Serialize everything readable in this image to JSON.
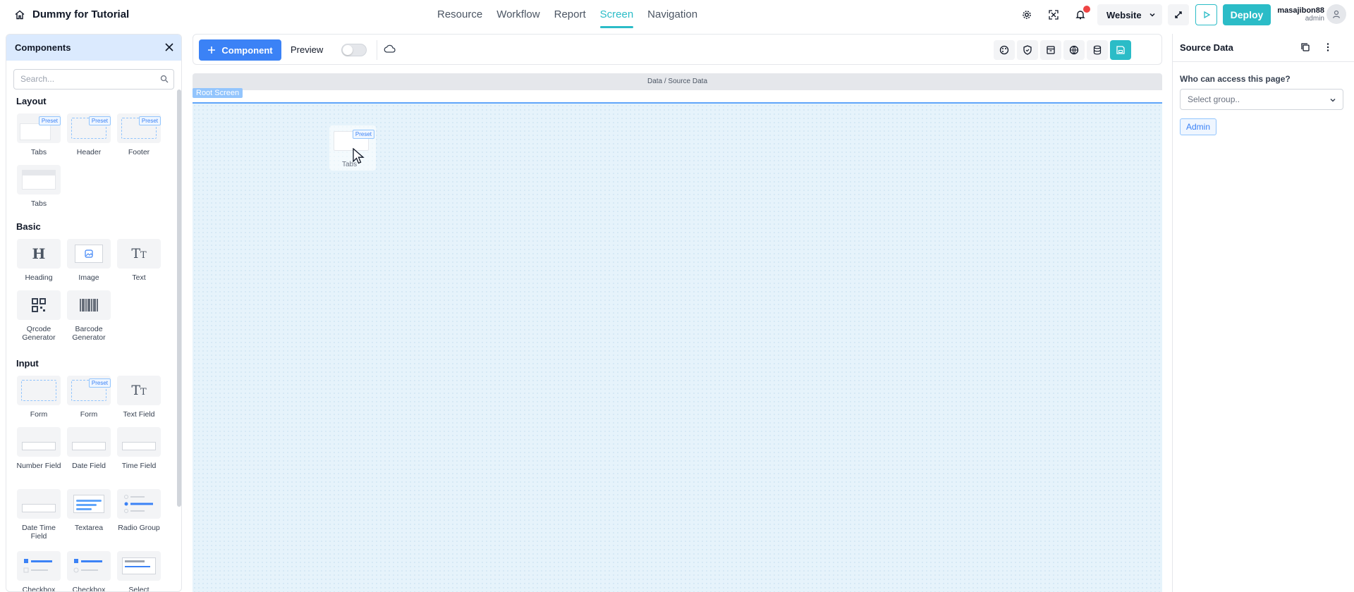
{
  "app": {
    "title": "Dummy for Tutorial"
  },
  "nav": {
    "items": [
      "Resource",
      "Workflow",
      "Report",
      "Screen",
      "Navigation"
    ],
    "active": "Screen"
  },
  "topbar": {
    "environment": "Website",
    "deploy_label": "Deploy",
    "user_name": "masajibon88",
    "user_role": "admin"
  },
  "left_panel": {
    "title": "Components",
    "search_placeholder": "Search...",
    "preset_label": "Preset",
    "sections": {
      "layout": {
        "title": "Layout",
        "items": [
          "Tabs",
          "Header",
          "Footer",
          "Tabs"
        ]
      },
      "basic": {
        "title": "Basic",
        "items": [
          "Heading",
          "Image",
          "Text",
          "Qrcode Generator",
          "Barcode Generator"
        ]
      },
      "input": {
        "title": "Input",
        "items": [
          "Form",
          "Form",
          "Text Field",
          "Number Field",
          "Date Field",
          "Time Field",
          "Date Time Field",
          "Textarea",
          "Radio Group",
          "Checkbox",
          "Checkbox",
          "Select"
        ]
      }
    }
  },
  "toolbar": {
    "component_label": "Component",
    "preview_label": "Preview",
    "preview_on": false
  },
  "canvas": {
    "breadcrumb": "Data / Source Data",
    "root_label": "Root Screen",
    "drag_label": "Tabs"
  },
  "right_panel": {
    "title": "Source Data",
    "access_label": "Who can access this page?",
    "group_placeholder": "Select group..",
    "selected_groups": [
      "Admin"
    ]
  },
  "colors": {
    "accent": "#2bbcc7",
    "primary": "#3b82f6",
    "canvas_bg": "#e6f3fb"
  }
}
